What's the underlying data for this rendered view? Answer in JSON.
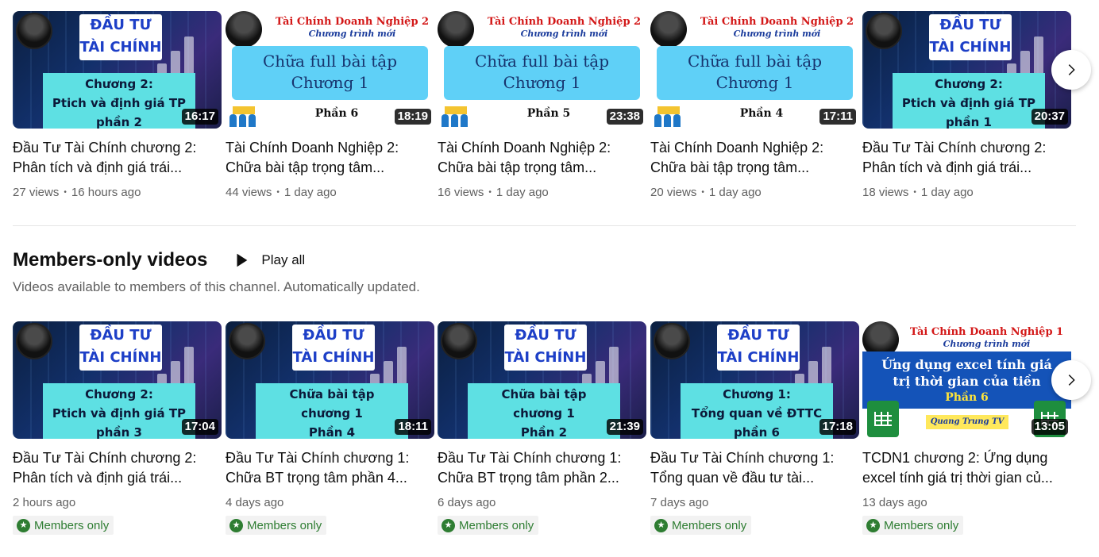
{
  "top_row": [
    {
      "thumb_type": "dt",
      "brand": [
        "ĐẦU TƯ",
        "TÀI CHÍNH"
      ],
      "sub": [
        "Chương 2:",
        "Ptich và định giá TP",
        "phần 2"
      ],
      "duration": "16:17",
      "title": [
        "Đầu Tư Tài Chính chương 2:",
        "Phân tích và định giá trái..."
      ],
      "views": "27 views",
      "age": "16 hours ago"
    },
    {
      "thumb_type": "tc",
      "header": "Tài Chính Doanh Nghiệp 2",
      "subheader": "Chương trình mới",
      "panel": [
        "Chữa full bài tập",
        "Chương 1"
      ],
      "part": "Phần 6",
      "duration": "18:19",
      "title": [
        "Tài Chính Doanh Nghiệp 2:",
        "Chữa bài tập trọng tâm..."
      ],
      "views": "44 views",
      "age": "1 day ago"
    },
    {
      "thumb_type": "tc",
      "header": "Tài Chính Doanh Nghiệp 2",
      "subheader": "Chương trình mới",
      "panel": [
        "Chữa full bài tập",
        "Chương 1"
      ],
      "part": "Phần 5",
      "duration": "23:38",
      "title": [
        "Tài Chính Doanh Nghiệp 2:",
        "Chữa bài tập trọng tâm..."
      ],
      "views": "16 views",
      "age": "1 day ago"
    },
    {
      "thumb_type": "tc",
      "header": "Tài Chính Doanh Nghiệp 2",
      "subheader": "Chương trình mới",
      "panel": [
        "Chữa full bài tập",
        "Chương 1"
      ],
      "part": "Phần 4",
      "duration": "17:11",
      "title": [
        "Tài Chính Doanh Nghiệp 2:",
        "Chữa bài tập trọng tâm..."
      ],
      "views": "20 views",
      "age": "1 day ago"
    },
    {
      "thumb_type": "dt",
      "brand": [
        "ĐẦU TƯ",
        "TÀI CHÍNH"
      ],
      "sub": [
        "Chương 2:",
        "Ptich và định giá TP",
        "phần 1"
      ],
      "duration": "20:37",
      "title": [
        "Đầu Tư Tài Chính chương 2:",
        "Phân tích và định giá trái..."
      ],
      "views": "18 views",
      "age": "1 day ago"
    }
  ],
  "section": {
    "title": "Members-only videos",
    "play_all": "Play all",
    "description": "Videos available to members of this channel. Automatically updated.",
    "members_label": "Members only"
  },
  "bottom_row": [
    {
      "thumb_type": "dt",
      "brand": [
        "ĐẦU TƯ",
        "TÀI CHÍNH"
      ],
      "sub": [
        "Chương 2:",
        "Ptich và định giá TP",
        "phần 3"
      ],
      "duration": "17:04",
      "title": [
        "Đầu Tư Tài Chính chương 2:",
        "Phân tích và định giá trái..."
      ],
      "age": "2 hours ago"
    },
    {
      "thumb_type": "dt",
      "brand": [
        "ĐẦU TƯ",
        "TÀI CHÍNH"
      ],
      "sub": [
        "Chữa bài tập",
        "chương 1",
        "Phần 4"
      ],
      "duration": "18:11",
      "title": [
        "Đầu Tư Tài Chính chương 1:",
        "Chữa BT trọng tâm phần 4..."
      ],
      "age": "4 days ago"
    },
    {
      "thumb_type": "dt",
      "brand": [
        "ĐẦU TƯ",
        "TÀI CHÍNH"
      ],
      "sub": [
        "Chữa bài tập",
        "chương 1",
        "Phần 2"
      ],
      "duration": "21:39",
      "title": [
        "Đầu Tư Tài Chính chương 1:",
        "Chữa BT trọng tâm phần 2..."
      ],
      "age": "6 days ago"
    },
    {
      "thumb_type": "dt",
      "brand": [
        "ĐẦU TƯ",
        "TÀI CHÍNH"
      ],
      "sub": [
        "Chương 1:",
        "Tổng quan về ĐTTC",
        "phần 6"
      ],
      "duration": "17:18",
      "title": [
        "Đầu Tư Tài Chính chương 1:",
        "Tổng quan về đầu tư tài..."
      ],
      "age": "7 days ago"
    },
    {
      "thumb_type": "ex",
      "header": "Tài Chính Doanh Nghiệp 1",
      "subheader": "Chương trình mới",
      "panel": [
        "Ứng dụng excel tính giá",
        "trị thời gian của tiền"
      ],
      "part": "Phần 6",
      "tag": "Quang Trung TV",
      "duration": "13:05",
      "title": [
        "TCDN1 chương 2: Ứng dụng",
        "excel tính giá trị thời gian củ..."
      ],
      "age": "13 days ago"
    }
  ],
  "icons": {
    "next": "chevron-right-icon",
    "play": "play-icon",
    "members": "star-badge-icon"
  },
  "colors": {
    "members_green": "#2e7d32",
    "secondary_text": "#606060"
  }
}
